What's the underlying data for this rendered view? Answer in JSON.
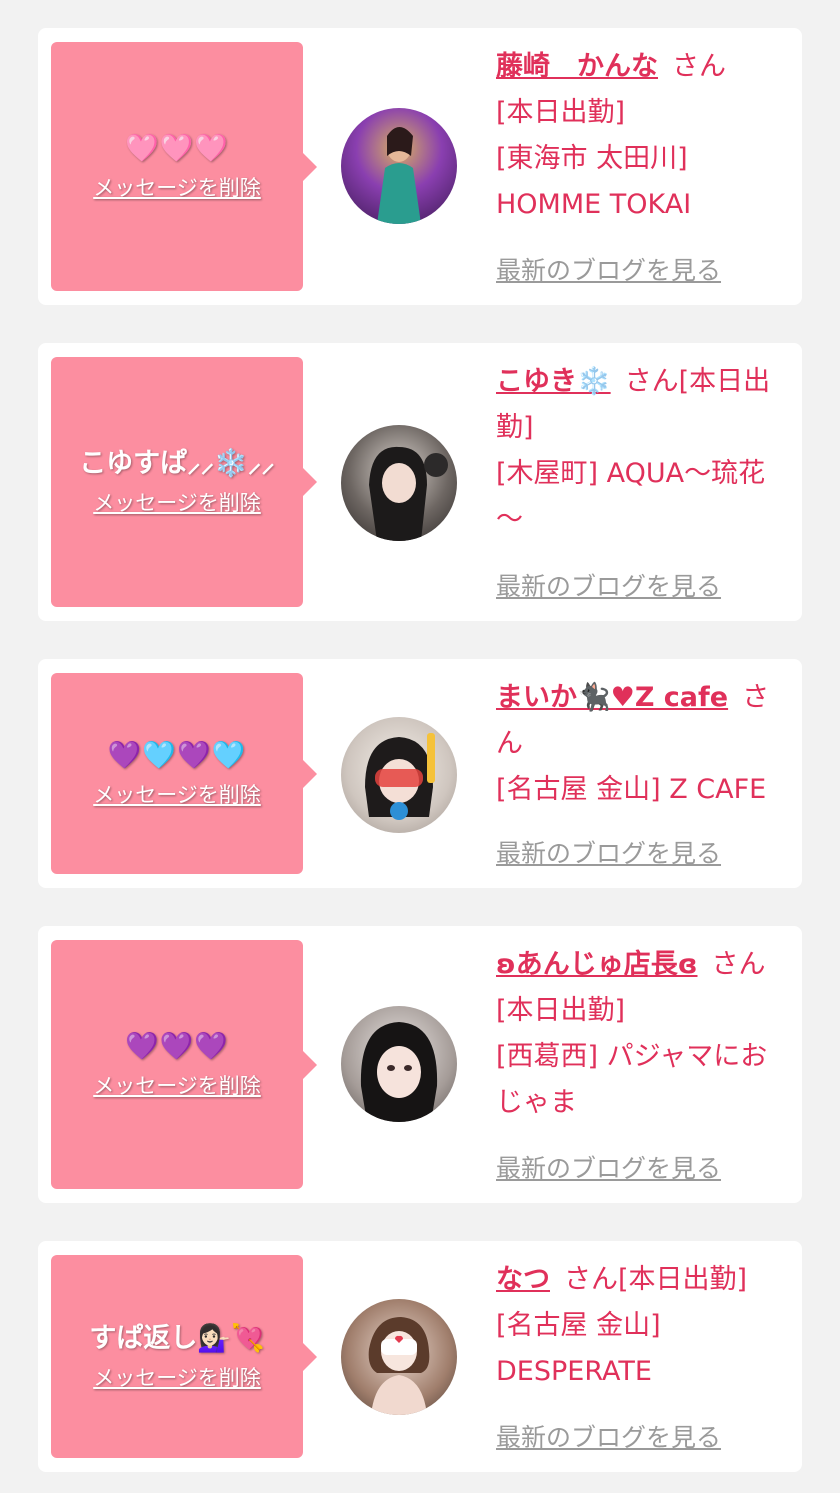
{
  "colors": {
    "page_bg": "#f2f2f2",
    "card_bg": "#ffffff",
    "bubble_pink": "#fc8ea0",
    "accent_text": "#e0305a",
    "blog_link_gray": "#9a9a9a"
  },
  "delete_label": "メッセージを削除",
  "blog_label": "最新のブログを見る",
  "san_label": "さん",
  "entries": [
    {
      "message": "🩷🩷🩷",
      "name": "藤崎　かんな",
      "status": "[本日出勤]",
      "shop": "[東海市 太田川] HOMME TOKAI",
      "avatar_icon": "avatar-photo-icon"
    },
    {
      "message": "こゆすぱ⸝⸝❄️⸝⸝",
      "name": "こゆき❄️",
      "status": "[本日出勤]",
      "shop": "[木屋町] AQUA～琉花～",
      "avatar_icon": "avatar-photo-icon"
    },
    {
      "message": "💜🩵💜🩵",
      "name": "まいか🐈‍⬛♥Z cafe",
      "status": "",
      "shop": "[名古屋 金山] Z CAFE",
      "avatar_icon": "avatar-photo-icon"
    },
    {
      "message": "💜💜💜",
      "name": "ʚあんじゅ店長ɞ",
      "status": "[本日出勤]",
      "shop": "[西葛西] パジャマにおじゃま",
      "avatar_icon": "avatar-photo-icon"
    },
    {
      "message": "すぱ返し💁🏻‍♀️💘",
      "name": "なつ",
      "status": "[本日出勤]",
      "shop": "[名古屋 金山] DESPERATE",
      "avatar_icon": "avatar-photo-icon"
    }
  ]
}
